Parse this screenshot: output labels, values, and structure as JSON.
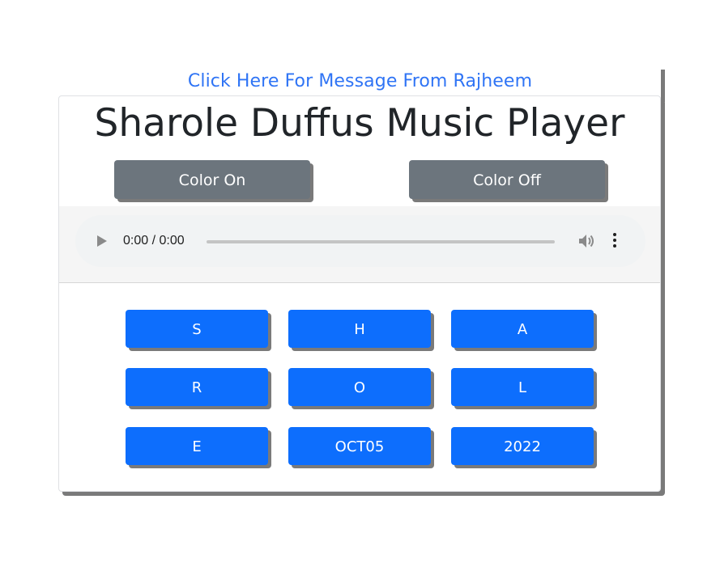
{
  "message_link": {
    "label": "Click Here For Message From Rajheem"
  },
  "card": {
    "title": "Sharole Duffus Music Player"
  },
  "color_controls": {
    "on_label": "Color On",
    "off_label": "Color Off",
    "button_color": "#6c757d"
  },
  "audio_player": {
    "time_display": "0:00 / 0:00",
    "progress": 0,
    "icons": [
      "play-icon",
      "volume-icon",
      "more-options-icon"
    ]
  },
  "letter_buttons": {
    "button_color": "#0d6efd",
    "labels": [
      "S",
      "H",
      "A",
      "R",
      "O",
      "L",
      "E",
      "OCT05",
      "2022"
    ]
  },
  "colors": {
    "link": "#2f74f5",
    "primary": "#0d6efd",
    "secondary": "#6c757d",
    "shadow": "#7a7a7a"
  }
}
